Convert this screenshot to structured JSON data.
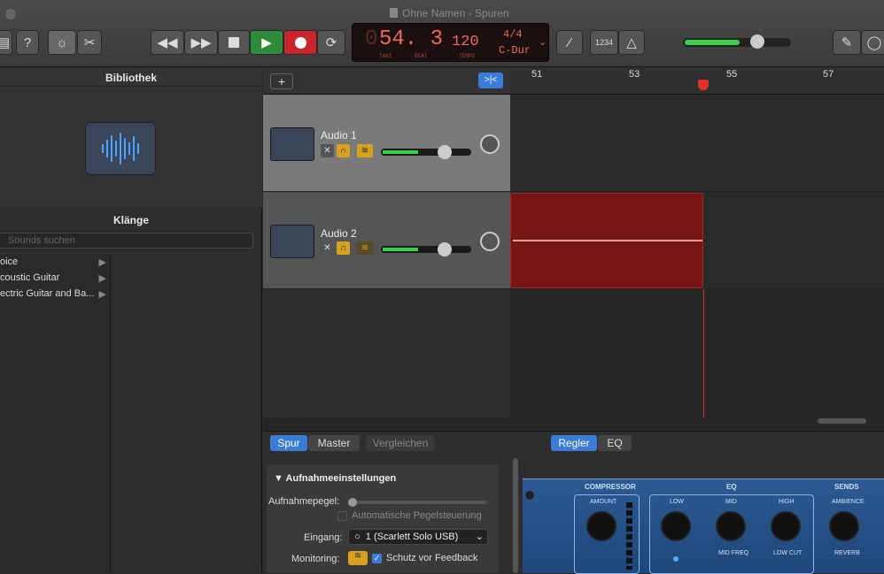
{
  "window": {
    "title": "Ohne Namen - Spuren"
  },
  "lcd": {
    "beat": "54. 3",
    "prefix": "0",
    "takt_label": "TAKT",
    "beat_label": "BEAT",
    "tempo": "120",
    "tempo_label": "TEMPO",
    "sig": "4/4",
    "key": "C-Dur"
  },
  "toolbar": {
    "count_in": "1234"
  },
  "library": {
    "title": "Bibliothek",
    "sounds_title": "Klänge",
    "search_placeholder": "Sounds suchen",
    "categories": [
      "oice",
      "coustic Guitar",
      "ectric Guitar and Ba..."
    ]
  },
  "tracks": [
    {
      "name": "Audio 1"
    },
    {
      "name": "Audio 2"
    }
  ],
  "ruler": {
    "bars": [
      "51",
      "53",
      "55",
      "57"
    ]
  },
  "smart": {
    "tab_track": "Spur",
    "tab_master": "Master",
    "compare": "Vergleichen",
    "tab_controls": "Regler",
    "tab_eq": "EQ",
    "section": "Aufnahmeeinstellungen",
    "level_label": "Aufnahmepegel:",
    "auto_level": "Automatische Pegelsteuerung",
    "input_label": "Eingang:",
    "input_value": "1  (Scarlett Solo USB)",
    "monitor_label": "Monitoring:",
    "feedback": "Schutz vor Feedback"
  },
  "plugin": {
    "compressor": "COMPRESSOR",
    "eq": "EQ",
    "sends": "SENDS",
    "amount": "AMOUNT",
    "low": "LOW",
    "mid": "MID",
    "high": "HIGH",
    "ambience": "AMBIENCE",
    "mid_freq": "MID FREQ",
    "low_cut": "LOW CUT",
    "reverb": "REVERB"
  },
  "colors": {
    "accent": "#3a7bd5",
    "region": "#7a1515",
    "play": "#2e8b3a",
    "record": "#c8262a"
  }
}
